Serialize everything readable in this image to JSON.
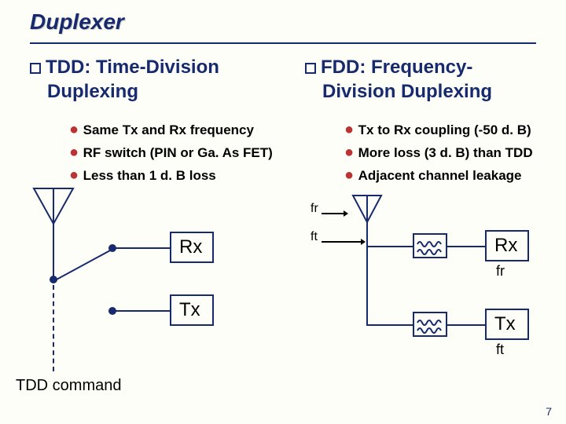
{
  "title": "Duplexer",
  "pageNumber": "7",
  "left": {
    "heading1": "TDD: Time-Division",
    "heading2": "Duplexing",
    "b1": "Same Tx and Rx frequency",
    "b2": "RF switch (PIN or Ga. As FET)",
    "b3": "Less than 1 d. B  loss",
    "rx": "Rx",
    "tx": "Tx",
    "cmd": "TDD command"
  },
  "right": {
    "heading1": "FDD: Frequency-",
    "heading2": "Division Duplexing",
    "b1": "Tx to Rx coupling (-50 d. B)",
    "b2": "More loss (3 d. B) than TDD",
    "b3": "Adjacent channel leakage",
    "rx": "Rx",
    "tx": "Tx",
    "fr": "fr",
    "ft": "ft",
    "fr2": "fr",
    "ft2": "ft"
  }
}
